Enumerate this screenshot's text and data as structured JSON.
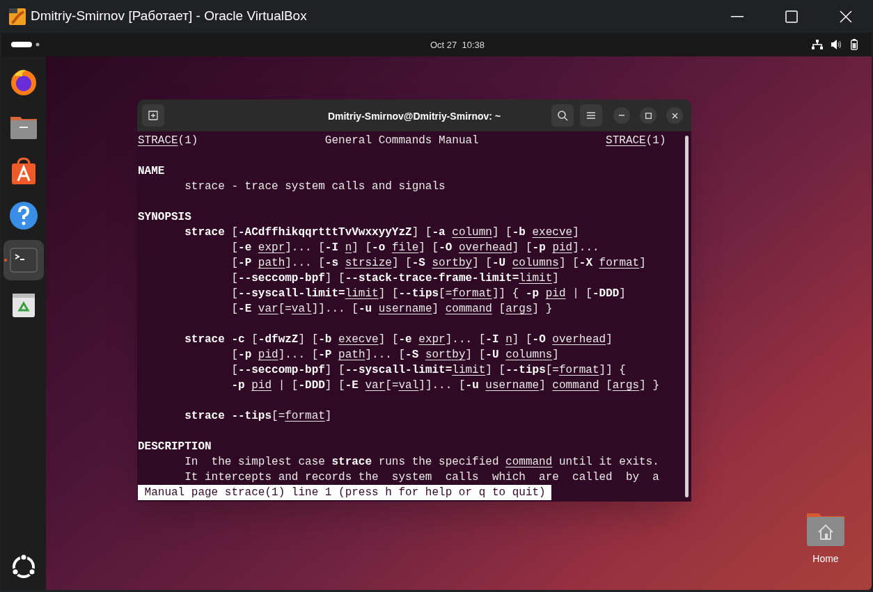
{
  "host_window": {
    "title": "Dmitriy-Smirnov [Работает] - Oracle VirtualBox"
  },
  "top_bar": {
    "clock": "Oct 27  10:38"
  },
  "dock": {
    "items": [
      {
        "kind": "browser",
        "running": false
      },
      {
        "kind": "files",
        "running": false
      },
      {
        "kind": "store",
        "running": false
      },
      {
        "kind": "help",
        "running": false
      },
      {
        "kind": "terminal",
        "running": true
      },
      {
        "kind": "trash",
        "running": false
      }
    ]
  },
  "desktop_icons": [
    {
      "label": "Home"
    }
  ],
  "terminal": {
    "title": "Dmitriy-Smirnov@Dmitriy-Smirnov: ~",
    "lines": [
      {
        "kind": "section",
        "segments": [
          {
            "kind": "underline",
            "text": "STRACE"
          },
          {
            "kind": "plain",
            "text": "(1)                   General Commands Manual                   "
          },
          {
            "kind": "underline",
            "text": "STRACE"
          },
          {
            "kind": "plain",
            "text": "(1)"
          }
        ]
      },
      {
        "kind": "blank"
      },
      {
        "kind": "section",
        "segments": [
          {
            "kind": "bold",
            "text": "NAME"
          }
        ]
      },
      {
        "kind": "body",
        "segments": [
          {
            "kind": "plain",
            "text": "strace - trace system calls and signals"
          }
        ]
      },
      {
        "kind": "blank"
      },
      {
        "kind": "section",
        "segments": [
          {
            "kind": "bold",
            "text": "SYNOPSIS"
          }
        ]
      },
      {
        "kind": "body",
        "segments": [
          {
            "kind": "bold",
            "text": "strace"
          },
          {
            "kind": "plain",
            "text": " ["
          },
          {
            "kind": "bold",
            "text": "-ACdffhikqqrtttTvVwxxyyYzZ"
          },
          {
            "kind": "plain",
            "text": "] ["
          },
          {
            "kind": "bold",
            "text": "-a "
          },
          {
            "kind": "underline",
            "text": "column"
          },
          {
            "kind": "plain",
            "text": "] ["
          },
          {
            "kind": "bold",
            "text": "-b "
          },
          {
            "kind": "underline",
            "text": "execve"
          },
          {
            "kind": "plain",
            "text": "]"
          }
        ]
      },
      {
        "kind": "wrap",
        "segments": [
          {
            "kind": "plain",
            "text": "["
          },
          {
            "kind": "bold",
            "text": "-e "
          },
          {
            "kind": "underline",
            "text": "expr"
          },
          {
            "kind": "plain",
            "text": "]... ["
          },
          {
            "kind": "bold",
            "text": "-I "
          },
          {
            "kind": "underline",
            "text": "n"
          },
          {
            "kind": "plain",
            "text": "] ["
          },
          {
            "kind": "bold",
            "text": "-o "
          },
          {
            "kind": "underline",
            "text": "file"
          },
          {
            "kind": "plain",
            "text": "] ["
          },
          {
            "kind": "bold",
            "text": "-O "
          },
          {
            "kind": "underline",
            "text": "overhead"
          },
          {
            "kind": "plain",
            "text": "] ["
          },
          {
            "kind": "bold",
            "text": "-p "
          },
          {
            "kind": "underline",
            "text": "pid"
          },
          {
            "kind": "plain",
            "text": "]..."
          }
        ]
      },
      {
        "kind": "wrap",
        "segments": [
          {
            "kind": "plain",
            "text": "["
          },
          {
            "kind": "bold",
            "text": "-P "
          },
          {
            "kind": "underline",
            "text": "path"
          },
          {
            "kind": "plain",
            "text": "]... ["
          },
          {
            "kind": "bold",
            "text": "-s "
          },
          {
            "kind": "underline",
            "text": "strsize"
          },
          {
            "kind": "plain",
            "text": "] ["
          },
          {
            "kind": "bold",
            "text": "-S "
          },
          {
            "kind": "underline",
            "text": "sortby"
          },
          {
            "kind": "plain",
            "text": "] ["
          },
          {
            "kind": "bold",
            "text": "-U "
          },
          {
            "kind": "underline",
            "text": "columns"
          },
          {
            "kind": "plain",
            "text": "] ["
          },
          {
            "kind": "bold",
            "text": "-X "
          },
          {
            "kind": "underline",
            "text": "format"
          },
          {
            "kind": "plain",
            "text": "]"
          }
        ]
      },
      {
        "kind": "wrap",
        "segments": [
          {
            "kind": "plain",
            "text": "["
          },
          {
            "kind": "bold",
            "text": "--seccomp-bpf"
          },
          {
            "kind": "plain",
            "text": "] ["
          },
          {
            "kind": "bold",
            "text": "--stack-trace-frame-limit="
          },
          {
            "kind": "underline",
            "text": "limit"
          },
          {
            "kind": "plain",
            "text": "]"
          }
        ]
      },
      {
        "kind": "wrap",
        "segments": [
          {
            "kind": "plain",
            "text": "["
          },
          {
            "kind": "bold",
            "text": "--syscall-limit="
          },
          {
            "kind": "underline",
            "text": "limit"
          },
          {
            "kind": "plain",
            "text": "] ["
          },
          {
            "kind": "bold",
            "text": "--tips"
          },
          {
            "kind": "plain",
            "text": "[="
          },
          {
            "kind": "underline",
            "text": "format"
          },
          {
            "kind": "plain",
            "text": "]] { "
          },
          {
            "kind": "bold",
            "text": "-p "
          },
          {
            "kind": "underline",
            "text": "pid"
          },
          {
            "kind": "plain",
            "text": " | ["
          },
          {
            "kind": "bold",
            "text": "-DDD"
          },
          {
            "kind": "plain",
            "text": "]"
          }
        ]
      },
      {
        "kind": "wrap",
        "segments": [
          {
            "kind": "plain",
            "text": "["
          },
          {
            "kind": "bold",
            "text": "-E "
          },
          {
            "kind": "underline",
            "text": "var"
          },
          {
            "kind": "plain",
            "text": "[="
          },
          {
            "kind": "underline",
            "text": "val"
          },
          {
            "kind": "plain",
            "text": "]]... ["
          },
          {
            "kind": "bold",
            "text": "-u "
          },
          {
            "kind": "underline",
            "text": "username"
          },
          {
            "kind": "plain",
            "text": "] "
          },
          {
            "kind": "underline",
            "text": "command"
          },
          {
            "kind": "plain",
            "text": " ["
          },
          {
            "kind": "underline",
            "text": "args"
          },
          {
            "kind": "plain",
            "text": "] }"
          }
        ]
      },
      {
        "kind": "blank"
      },
      {
        "kind": "body",
        "segments": [
          {
            "kind": "bold",
            "text": "strace -c"
          },
          {
            "kind": "plain",
            "text": " ["
          },
          {
            "kind": "bold",
            "text": "-dfwzZ"
          },
          {
            "kind": "plain",
            "text": "] ["
          },
          {
            "kind": "bold",
            "text": "-b "
          },
          {
            "kind": "underline",
            "text": "execve"
          },
          {
            "kind": "plain",
            "text": "] ["
          },
          {
            "kind": "bold",
            "text": "-e "
          },
          {
            "kind": "underline",
            "text": "expr"
          },
          {
            "kind": "plain",
            "text": "]... ["
          },
          {
            "kind": "bold",
            "text": "-I "
          },
          {
            "kind": "underline",
            "text": "n"
          },
          {
            "kind": "plain",
            "text": "] ["
          },
          {
            "kind": "bold",
            "text": "-O "
          },
          {
            "kind": "underline",
            "text": "overhead"
          },
          {
            "kind": "plain",
            "text": "]"
          }
        ]
      },
      {
        "kind": "wrap",
        "segments": [
          {
            "kind": "plain",
            "text": "["
          },
          {
            "kind": "bold",
            "text": "-p "
          },
          {
            "kind": "underline",
            "text": "pid"
          },
          {
            "kind": "plain",
            "text": "]... ["
          },
          {
            "kind": "bold",
            "text": "-P "
          },
          {
            "kind": "underline",
            "text": "path"
          },
          {
            "kind": "plain",
            "text": "]... ["
          },
          {
            "kind": "bold",
            "text": "-S "
          },
          {
            "kind": "underline",
            "text": "sortby"
          },
          {
            "kind": "plain",
            "text": "] ["
          },
          {
            "kind": "bold",
            "text": "-U "
          },
          {
            "kind": "underline",
            "text": "columns"
          },
          {
            "kind": "plain",
            "text": "]"
          }
        ]
      },
      {
        "kind": "wrap",
        "segments": [
          {
            "kind": "plain",
            "text": "["
          },
          {
            "kind": "bold",
            "text": "--seccomp-bpf"
          },
          {
            "kind": "plain",
            "text": "] ["
          },
          {
            "kind": "bold",
            "text": "--syscall-limit="
          },
          {
            "kind": "underline",
            "text": "limit"
          },
          {
            "kind": "plain",
            "text": "] ["
          },
          {
            "kind": "bold",
            "text": "--tips"
          },
          {
            "kind": "plain",
            "text": "[="
          },
          {
            "kind": "underline",
            "text": "format"
          },
          {
            "kind": "plain",
            "text": "]] {"
          }
        ]
      },
      {
        "kind": "wrap",
        "segments": [
          {
            "kind": "bold",
            "text": "-p "
          },
          {
            "kind": "underline",
            "text": "pid"
          },
          {
            "kind": "plain",
            "text": " | ["
          },
          {
            "kind": "bold",
            "text": "-DDD"
          },
          {
            "kind": "plain",
            "text": "] ["
          },
          {
            "kind": "bold",
            "text": "-E "
          },
          {
            "kind": "underline",
            "text": "var"
          },
          {
            "kind": "plain",
            "text": "[="
          },
          {
            "kind": "underline",
            "text": "val"
          },
          {
            "kind": "plain",
            "text": "]]... ["
          },
          {
            "kind": "bold",
            "text": "-u "
          },
          {
            "kind": "underline",
            "text": "username"
          },
          {
            "kind": "plain",
            "text": "] "
          },
          {
            "kind": "underline",
            "text": "command"
          },
          {
            "kind": "plain",
            "text": " ["
          },
          {
            "kind": "underline",
            "text": "args"
          },
          {
            "kind": "plain",
            "text": "] }"
          }
        ]
      },
      {
        "kind": "blank"
      },
      {
        "kind": "body",
        "segments": [
          {
            "kind": "bold",
            "text": "strace --tips"
          },
          {
            "kind": "plain",
            "text": "[="
          },
          {
            "kind": "underline",
            "text": "format"
          },
          {
            "kind": "plain",
            "text": "]"
          }
        ]
      },
      {
        "kind": "blank"
      },
      {
        "kind": "section",
        "segments": [
          {
            "kind": "bold",
            "text": "DESCRIPTION"
          }
        ]
      },
      {
        "kind": "body",
        "segments": [
          {
            "kind": "plain",
            "text": "In  the simplest case "
          },
          {
            "kind": "bold",
            "text": "strace"
          },
          {
            "kind": "plain",
            "text": " runs the specified "
          },
          {
            "kind": "underline",
            "text": "command"
          },
          {
            "kind": "plain",
            "text": " until it exits."
          }
        ]
      },
      {
        "kind": "body",
        "segments": [
          {
            "kind": "plain",
            "text": "It intercepts and records the  system  calls  which  are  called  by  a"
          }
        ]
      }
    ],
    "status_line": "Manual page strace(1) line 1 (press h for help or q to quit)"
  }
}
